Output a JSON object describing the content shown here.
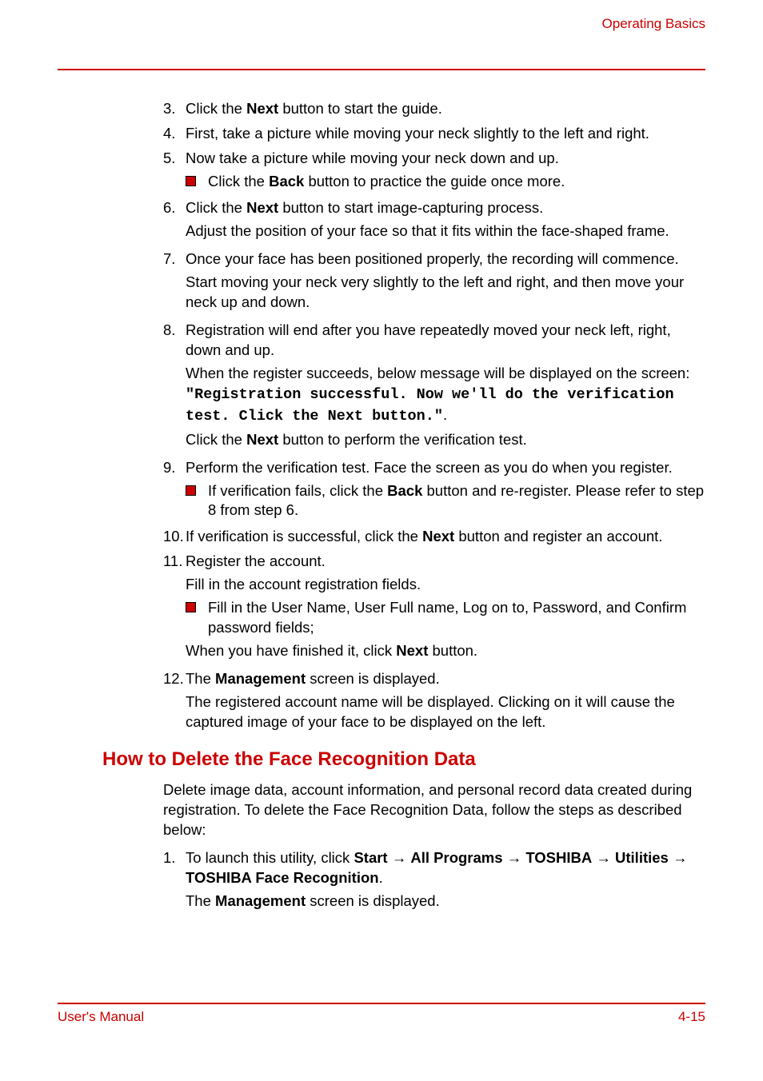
{
  "header": {
    "section_title": "Operating Basics"
  },
  "steps": {
    "s3": {
      "num": "3.",
      "text_a": "Click the ",
      "bold": "Next",
      "text_b": " button to start the guide."
    },
    "s4": {
      "num": "4.",
      "text": "First, take a picture while moving your neck slightly to the left and right."
    },
    "s5": {
      "num": "5.",
      "text": "Now take a picture while moving your neck down and up.",
      "bullet": {
        "a": "Click the ",
        "bold": "Back",
        "b": " button to practice the guide once more."
      }
    },
    "s6": {
      "num": "6.",
      "line1_a": "Click the ",
      "line1_bold": "Next",
      "line1_b": " button to start image-capturing process.",
      "para2": "Adjust the position of your face so that it fits within the face-shaped frame."
    },
    "s7": {
      "num": "7.",
      "line1": "Once your face has been positioned properly, the recording will commence.",
      "para2": "Start moving your neck very slightly to the left and right, and then move your neck up and down."
    },
    "s8": {
      "num": "8.",
      "line1": "Registration will end after you have repeatedly moved your neck left, right, down and up.",
      "p2a": "When the register succeeds, below message will be displayed on the screen: ",
      "p2mono": "\"Registration successful. Now we'll do the verification test. Click the Next button.\"",
      "p2b": ".",
      "p3a": "Click the ",
      "p3bold": "Next",
      "p3b": " button to perform the verification test."
    },
    "s9": {
      "num": "9.",
      "line1": "Perform the verification test. Face the screen as you do when you register.",
      "bullet": {
        "a": "If verification fails, click the ",
        "bold": "Back",
        "b": " button and re-register. Please refer to step 8 from step 6."
      }
    },
    "s10": {
      "num": "10.",
      "a": "If verification is successful, click the ",
      "bold": "Next",
      "b": " button and register an account."
    },
    "s11": {
      "num": "11.",
      "line1": "Register the account.",
      "para2": "Fill in the account registration fields.",
      "bullet": {
        "text": "Fill in the User Name, User Full name, Log on to, Password, and Confirm password fields;"
      },
      "p3a": "When you have finished it, click ",
      "p3bold": "Next",
      "p3b": " button."
    },
    "s12": {
      "num": "12.",
      "a": "The ",
      "bold": "Management",
      "b": " screen is displayed.",
      "para2": "The registered account name will be displayed. Clicking on it will cause the captured image of your face to be displayed on the left."
    }
  },
  "section2": {
    "heading": "How to Delete the Face Recognition Data",
    "intro": "Delete image data, account information, and personal record data created during registration. To delete the Face Recognition Data, follow the steps as described below:",
    "s1": {
      "num": "1.",
      "a": "To launch this utility, click ",
      "b1": "Start",
      "arr1": " → ",
      "b2": "All Programs",
      "arr2": " → ",
      "b3": "TOSHIBA",
      "arr3": " → ",
      "b4": "Utilities",
      "arr4": " → ",
      "b5": "TOSHIBA Face Recognition",
      "end": ".",
      "p2a": "The ",
      "p2bold": "Management",
      "p2b": " screen is displayed."
    }
  },
  "footer": {
    "left": "User's Manual",
    "right": "4-15"
  }
}
